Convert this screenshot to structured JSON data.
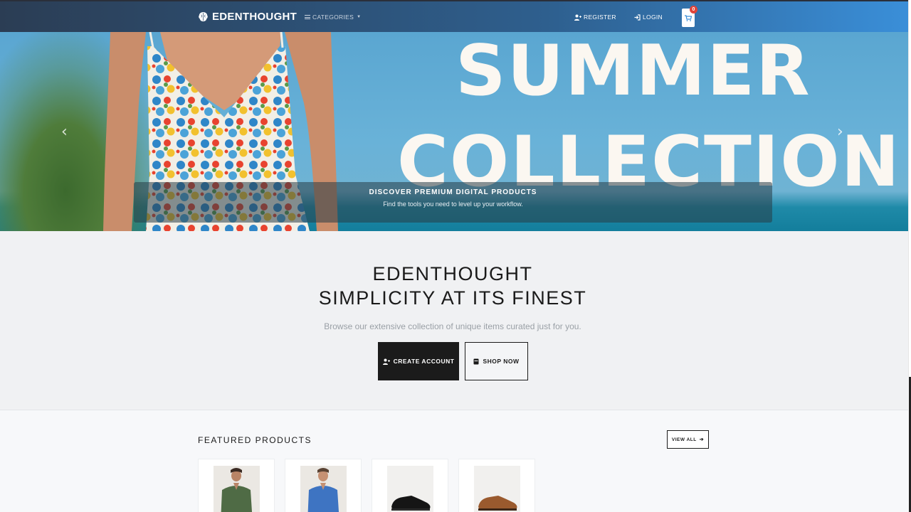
{
  "navbar": {
    "brand": "EDENTHOUGHT",
    "categories_label": "CATEGORIES",
    "register_label": "REGISTER",
    "login_label": "LOGIN",
    "cart_count": "0"
  },
  "hero": {
    "title_line1": "SUMMER",
    "title_line2": "COLLECTION",
    "caption_heading": "DISCOVER PREMIUM DIGITAL PRODUCTS",
    "caption_text": "Find the tools you need to level up your workflow.",
    "prev_arrow": "‹",
    "next_arrow": "›"
  },
  "intro": {
    "heading_line1": "EDENTHOUGHT",
    "heading_line2": "SIMPLICITY AT ITS FINEST",
    "subtitle": "Browse our extensive collection of unique items curated just for you.",
    "create_account_label": "CREATE ACCOUNT",
    "shop_now_label": "SHOP NOW"
  },
  "featured": {
    "title": "FEATURED PRODUCTS",
    "view_all_label": "VIEW ALL",
    "products": [
      {
        "image": "green-shirt-man"
      },
      {
        "image": "blue-shirt-man"
      },
      {
        "image": "black-dress-shoe"
      },
      {
        "image": "brown-dress-shoe"
      }
    ]
  },
  "colors": {
    "navbar_start": "#2b3d54",
    "navbar_end": "#3a8fd9",
    "badge": "#e0443a",
    "primary_button": "#1b1b1b"
  }
}
